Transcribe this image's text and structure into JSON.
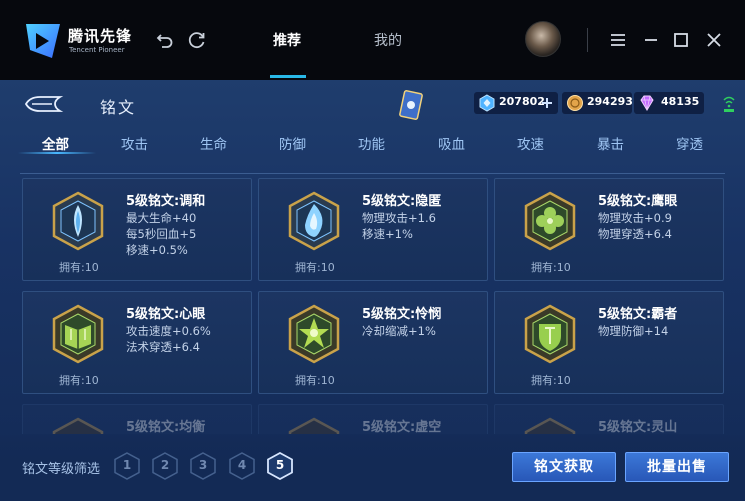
{
  "app": {
    "logo_name": "腾讯先锋",
    "logo_sub": "Tencent Pioneer",
    "nav_tabs": [
      {
        "label": "推荐",
        "active": true
      },
      {
        "label": "我的",
        "active": false
      }
    ],
    "controls": [
      "undo-icon",
      "refresh-icon",
      "menu-icon",
      "minimize-icon",
      "maximize-icon",
      "close-icon"
    ]
  },
  "page": {
    "title": "铭文",
    "currencies": [
      {
        "name": "diamond",
        "value": "207802",
        "color": "#4fb3ff"
      },
      {
        "name": "coin",
        "value": "294293",
        "color": "#e2a44a"
      },
      {
        "name": "gem",
        "value": "48135",
        "color": "#c36cff"
      }
    ],
    "categories": [
      {
        "label": "全部",
        "active": true
      },
      {
        "label": "攻击",
        "active": false
      },
      {
        "label": "生命",
        "active": false
      },
      {
        "label": "防御",
        "active": false
      },
      {
        "label": "功能",
        "active": false
      },
      {
        "label": "吸血",
        "active": false
      },
      {
        "label": "攻速",
        "active": false
      },
      {
        "label": "暴击",
        "active": false
      },
      {
        "label": "穿透",
        "active": false
      }
    ]
  },
  "runes": [
    {
      "name": "5级铭文:调和",
      "stats": [
        "最大生命+40",
        "每5秒回血+5",
        "移速+0.5%"
      ],
      "owned": "拥有:10",
      "color": "#8fd0ff",
      "icon": "water-drop-rune-icon"
    },
    {
      "name": "5级铭文:隐匿",
      "stats": [
        "物理攻击+1.6",
        "移速+1%"
      ],
      "owned": "拥有:10",
      "color": "#5fb7ff",
      "icon": "flame-rune-icon"
    },
    {
      "name": "5级铭文:鹰眼",
      "stats": [
        "物理攻击+0.9",
        "物理穿透+6.4"
      ],
      "owned": "拥有:10",
      "color": "#8fcf4a",
      "icon": "clover-rune-icon"
    },
    {
      "name": "5级铭文:心眼",
      "stats": [
        "攻击速度+0.6%",
        "法术穿透+6.4"
      ],
      "owned": "拥有:10",
      "color": "#9bd04c",
      "icon": "book-rune-icon"
    },
    {
      "name": "5级铭文:怜悯",
      "stats": [
        "冷却缩减+1%"
      ],
      "owned": "拥有:10",
      "color": "#a6d84a",
      "icon": "star-rune-icon"
    },
    {
      "name": "5级铭文:霸者",
      "stats": [
        "物理防御+14"
      ],
      "owned": "拥有:10",
      "color": "#8ecb4a",
      "icon": "shield-rune-icon"
    },
    {
      "name": "5级铭文:均衡",
      "stats": [],
      "owned": "",
      "color": "#d9a648",
      "icon": "balance-rune-icon"
    },
    {
      "name": "5级铭文:虚空",
      "stats": [],
      "owned": "",
      "color": "#d9a648",
      "icon": "void-rune-icon"
    },
    {
      "name": "5级铭文:灵山",
      "stats": [],
      "owned": "",
      "color": "#d9a648",
      "icon": "mountain-rune-icon"
    }
  ],
  "footer": {
    "filter_label": "铭文等级筛选",
    "levels": [
      {
        "label": "1",
        "active": false
      },
      {
        "label": "2",
        "active": false
      },
      {
        "label": "3",
        "active": false
      },
      {
        "label": "4",
        "active": false
      },
      {
        "label": "5",
        "active": true
      }
    ],
    "get_button": "铭文获取",
    "sell_button": "批量出售"
  }
}
